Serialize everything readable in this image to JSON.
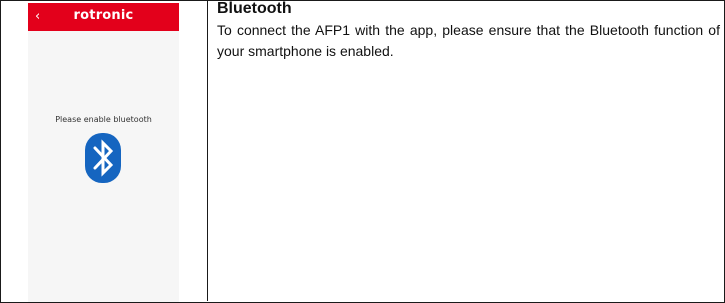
{
  "phone": {
    "back_icon": "‹",
    "brand": "rotronic",
    "prompt": "Please enable bluetooth",
    "icon": "bluetooth-icon",
    "header_color": "#e3001b",
    "icon_color": "#1565c0"
  },
  "section": {
    "heading": "Bluetooth",
    "text": "To connect the AFP1 with the app, please ensure that the Bluetooth function of your smartphone is enabled."
  }
}
